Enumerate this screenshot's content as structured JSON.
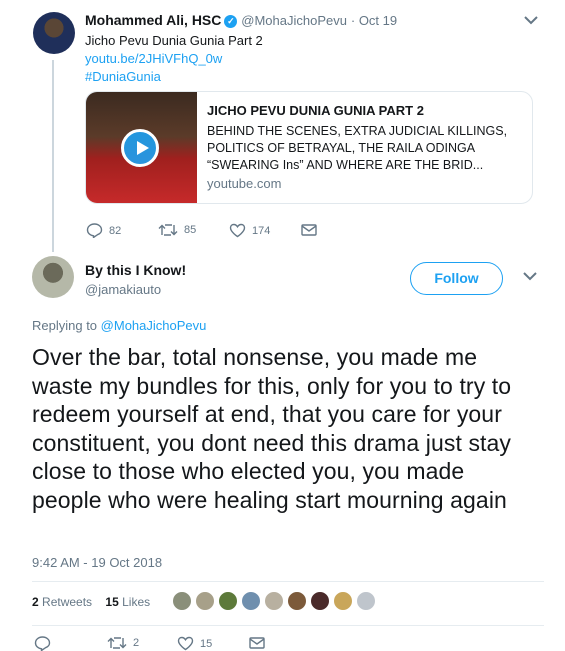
{
  "parent": {
    "name": "Mohammed Ali, HSC",
    "handle": "@MohaJichoPevu",
    "date": "· Oct 19",
    "text": "Jicho Pevu Dunia Gunia Part 2",
    "link": "youtu.be/2JHiVFhQ_0w",
    "hashtag": "#DuniaGunia",
    "card": {
      "title": "JICHO PEVU DUNIA GUNIA PART 2",
      "description": "BEHIND THE SCENES, EXTRA JUDICIAL KILLINGS, POLITICS OF BETRAYAL, THE RAILA ODINGA “SWEARING Ins” AND WHERE ARE THE BRID...",
      "domain": "youtube.com"
    },
    "replies": "82",
    "retweets": "85",
    "likes": "174"
  },
  "reply": {
    "name": "By this I Know!",
    "handle": "@jamakiauto",
    "follow_label": "Follow",
    "replying_prefix": "Replying to",
    "replying_to": "@MohaJichoPevu",
    "text": "Over the bar, total nonsense,  you made me waste my bundles for this, only for you to try to redeem yourself at end, that you care for your constituent, you dont need this drama just stay close to those who elected you, you made people who were healing start mourning  again",
    "timestamp": "9:42 AM - 19 Oct 2018",
    "retweets_count": "2",
    "retweets_label": "Retweets",
    "likes_count": "15",
    "likes_label": "Likes",
    "liker_avatars": [
      "#8a8f7a",
      "#a7a089",
      "#5d7a3a",
      "#6f8fae",
      "#b8b0a0",
      "#7c5a3a",
      "#4a2a2a",
      "#c9a65a",
      "#bfc5cc"
    ],
    "action_retweets": "2",
    "action_likes": "15"
  },
  "icons": {
    "reply": "reply-icon",
    "retweet": "retweet-icon",
    "like": "heart-icon",
    "dm": "envelope-icon",
    "verified": "verified-icon",
    "chevron": "chevron-down-icon"
  },
  "colors": {
    "accent": "#1da1f2",
    "secondary_text": "#657786"
  }
}
